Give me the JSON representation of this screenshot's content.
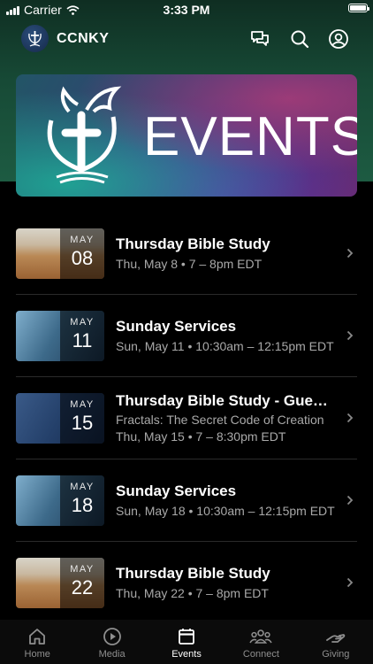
{
  "status_bar": {
    "carrier": "Carrier",
    "time": "3:33 PM"
  },
  "header": {
    "app_name": "CCNKY"
  },
  "banner": {
    "title": "EVENTS"
  },
  "events": [
    {
      "month": "MAY",
      "day": "08",
      "title": "Thursday Bible Study",
      "subtitle": "Thu, May 8 • 7 – 8pm EDT",
      "thumb": "desert"
    },
    {
      "month": "MAY",
      "day": "11",
      "title": "Sunday Services",
      "subtitle": "Sun, May 11 • 10:30am – 12:15pm EDT",
      "thumb": "bible"
    },
    {
      "month": "MAY",
      "day": "15",
      "title": "Thursday Bible Study - Guest...",
      "subtitle": "Fractals: The Secret Code of Creation",
      "subtitle2": "Thu, May 15 • 7 – 8:30pm EDT",
      "thumb": "person"
    },
    {
      "month": "MAY",
      "day": "18",
      "title": "Sunday Services",
      "subtitle": "Sun, May 18 • 10:30am – 12:15pm EDT",
      "thumb": "bible"
    },
    {
      "month": "MAY",
      "day": "22",
      "title": "Thursday Bible Study",
      "subtitle": "Thu, May 22 • 7 – 8pm EDT",
      "thumb": "desert"
    }
  ],
  "tabs": [
    {
      "label": "Home",
      "icon": "home-icon"
    },
    {
      "label": "Media",
      "icon": "play-icon"
    },
    {
      "label": "Events",
      "icon": "calendar-icon",
      "active": true
    },
    {
      "label": "Connect",
      "icon": "people-icon"
    },
    {
      "label": "Giving",
      "icon": "giving-hand-icon"
    }
  ]
}
